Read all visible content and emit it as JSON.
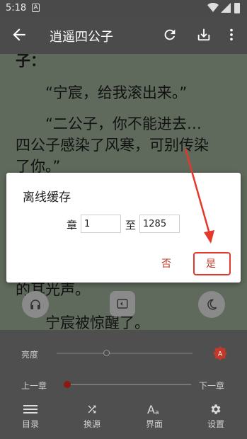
{
  "status": {
    "time": "5:18",
    "notif": "A"
  },
  "toolbar": {
    "title": "逍遥四公子"
  },
  "reader": {
    "lines": [
      "子：",
      "“宁宸，给我滚出来。”",
      "“二公子，你不能进去…",
      "四公子感染了风寒，可别传染",
      "了你。”",
      "的耳光声。",
      "宁宸被惊醒了。"
    ]
  },
  "dialog": {
    "title": "离线缓存",
    "chapter_label": "章",
    "to_label": "至",
    "from_value": "1",
    "to_value": "1285",
    "no_label": "否",
    "yes_label": "是"
  },
  "panel": {
    "brightness_label": "亮度",
    "prev_chapter": "上一章",
    "next_chapter": "下一章",
    "chapter_progress": 0,
    "auto_badge": "A",
    "accent_color": "#c0392b",
    "nav": [
      {
        "label": "目录",
        "icon": "list-icon"
      },
      {
        "label": "换源",
        "icon": "shuffle-icon"
      },
      {
        "label": "界面",
        "icon": "font-icon"
      },
      {
        "label": "设置",
        "icon": "settings-icon"
      }
    ]
  }
}
